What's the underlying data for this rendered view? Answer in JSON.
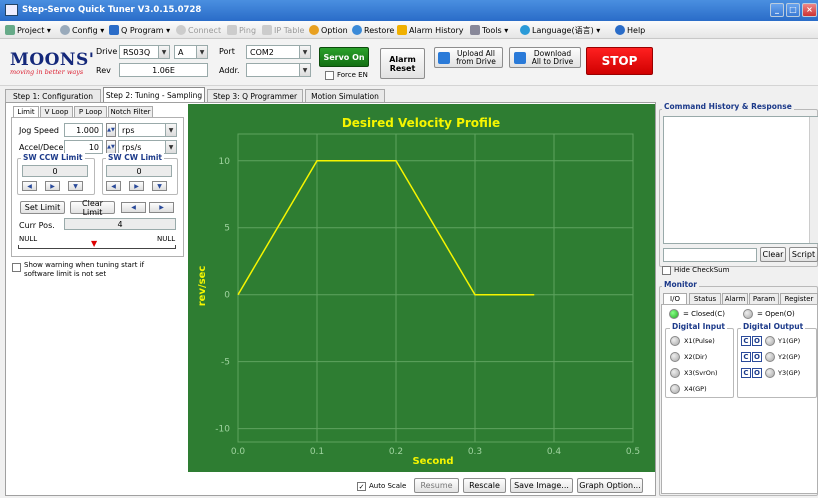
{
  "window": {
    "title": "Step-Servo Quick Tuner V3.0.15.0728",
    "controls": [
      "_",
      "□",
      "×"
    ]
  },
  "menu": [
    {
      "label": "Project ▾",
      "icon": "project-icon",
      "enabled": true
    },
    {
      "label": "Config ▾",
      "icon": "config-icon",
      "enabled": true
    },
    {
      "label": "Q Program ▾",
      "icon": "q-program-icon",
      "enabled": true
    },
    {
      "label": "Connect",
      "icon": "connect-icon",
      "enabled": false
    },
    {
      "label": "Ping",
      "icon": "ping-icon",
      "enabled": false
    },
    {
      "label": "IP Table",
      "icon": "ip-table-icon",
      "enabled": false
    },
    {
      "label": "Option",
      "icon": "option-icon",
      "enabled": true
    },
    {
      "label": "Restore",
      "icon": "restore-icon",
      "enabled": true
    },
    {
      "label": "Alarm History",
      "icon": "alarm-history-icon",
      "enabled": true
    },
    {
      "label": "Tools ▾",
      "icon": "tools-icon",
      "enabled": true
    },
    {
      "label": "Language(语言) ▾",
      "icon": "language-icon",
      "enabled": true
    },
    {
      "label": "Help",
      "icon": "help-icon",
      "enabled": true
    }
  ],
  "toolbar": {
    "logo": "MOONS'",
    "tagline": "moving in better ways",
    "drive_label": "Drive",
    "drive_value": "RS03Q",
    "drive_suffix": "A",
    "rev_label": "Rev",
    "rev_value": "1.06E",
    "port_label": "Port",
    "port_value": "COM2",
    "addr_label": "Addr.",
    "addr_value": "",
    "servo_on": "Servo On",
    "force_en": "Force EN",
    "alarm_reset": "Alarm Reset",
    "upload": "Upload All from Drive",
    "download": "Download All to Drive",
    "stop": "STOP"
  },
  "main_tabs": [
    "Step 1: Configuration",
    "Step 2: Tuning - Sampling",
    "Step 3: Q Programmer",
    "Motion Simulation"
  ],
  "sub_tabs": [
    "Limit",
    "V Loop",
    "P Loop",
    "Notch Filter"
  ],
  "limit": {
    "jog_speed_label": "Jog Speed",
    "jog_speed_value": "1.000",
    "jog_speed_unit": "rps",
    "accel_label": "Accel/Decel",
    "accel_value": "10",
    "accel_unit": "rps/s",
    "ccw_title": "SW CCW Limit",
    "ccw_value": "0",
    "cw_title": "SW CW Limit",
    "cw_value": "0",
    "set_limit": "Set Limit",
    "clear_limit": "Clear Limit",
    "curr_pos_label": "Curr Pos.",
    "curr_pos_value": "4",
    "null_left": "NULL",
    "null_right": "NULL",
    "warning": "Show warning when tuning start if software limit is not set"
  },
  "chart_data": {
    "type": "line",
    "title": "Desired Velocity Profile",
    "xlabel": "Second",
    "ylabel": "rev/sec",
    "xlim": [
      0,
      0.5
    ],
    "ylim": [
      -11,
      12
    ],
    "xticks": [
      "0.0",
      "0.1",
      "0.2",
      "0.3",
      "0.4",
      "0.5"
    ],
    "yticks": [
      "10",
      "5",
      "0",
      "-5",
      "-10"
    ],
    "grid": true,
    "series": [
      {
        "x": [
          0,
          0.1,
          0.2,
          0.3,
          0.375
        ],
        "y": [
          0,
          10,
          10,
          0,
          0
        ]
      }
    ],
    "colors": {
      "background": "#2e7d32",
      "line": "#f5f500",
      "grid": "#5fa35f",
      "text": "#f5f500"
    }
  },
  "chart_controls": {
    "auto_scale": "Auto Scale",
    "resume": "Resume",
    "rescale": "Rescale",
    "save_image": "Save Image...",
    "graph_option": "Graph Option..."
  },
  "right": {
    "cmd_title": "Command History & Response",
    "clear": "Clear",
    "script": "Script",
    "hide_checksum": "Hide CheckSum",
    "monitor_title": "Monitor",
    "monitor_tabs": [
      "I/O",
      "Status",
      "Alarm",
      "Param",
      "Register"
    ],
    "closed_legend": "= Closed(C)",
    "open_legend": "= Open(O)",
    "din_title": "Digital Input",
    "dout_title": "Digital Output",
    "inputs": [
      "X1(Pulse)",
      "X2(Dir)",
      "X3(SvrOn)",
      "X4(GP)"
    ],
    "outputs": [
      "Y1(GP)",
      "Y2(GP)",
      "Y3(GP)"
    ]
  }
}
